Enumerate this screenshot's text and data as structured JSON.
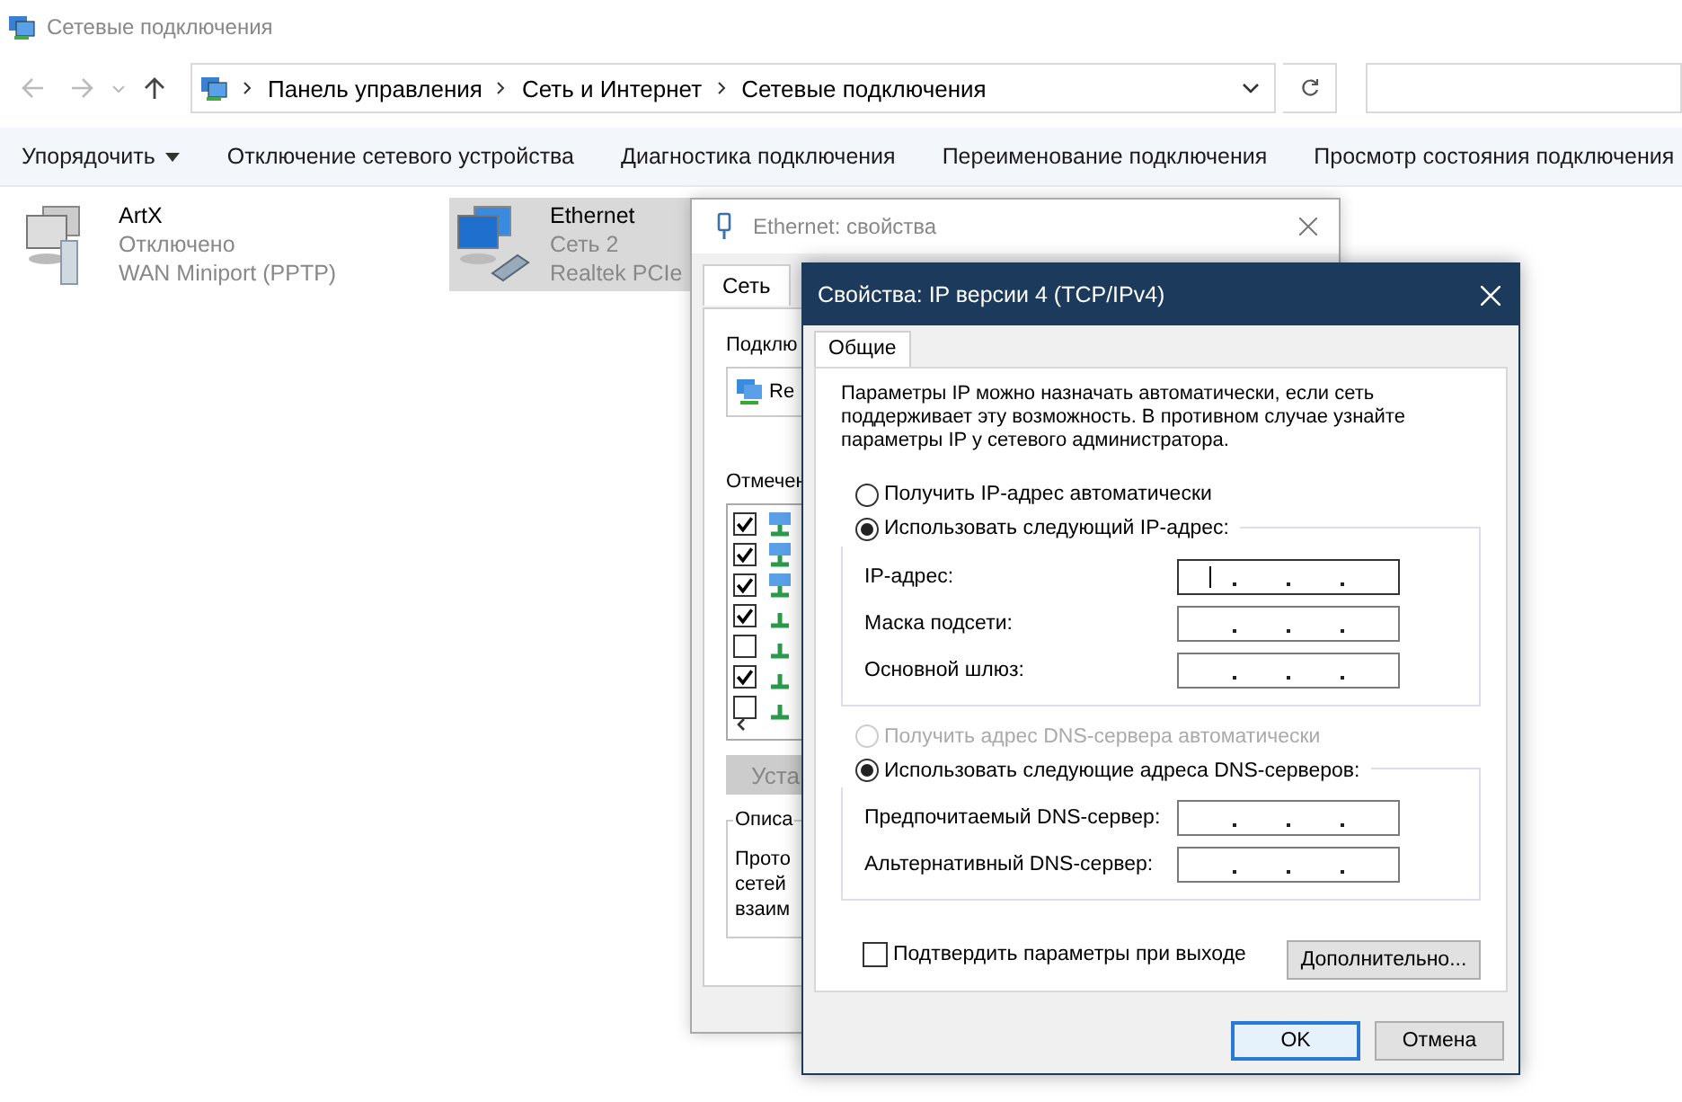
{
  "explorer": {
    "title": "Сетевые подключения",
    "breadcrumb": [
      "Панель управления",
      "Сеть и Интернет",
      "Сетевые подключения"
    ],
    "toolbar": [
      {
        "label": "Упорядочить",
        "dropdown": true
      },
      {
        "label": "Отключение сетевого устройства",
        "dropdown": false
      },
      {
        "label": "Диагностика подключения",
        "dropdown": false
      },
      {
        "label": "Переименование подключения",
        "dropdown": false
      },
      {
        "label": "Просмотр состояния подключения",
        "dropdown": false
      }
    ],
    "connections": [
      {
        "name": "ArtX",
        "status": "Отключено",
        "device": "WAN Miniport (PPTP)",
        "kind": "vpn",
        "selected": false
      },
      {
        "name": "Ethernet",
        "status": "Сеть 2",
        "device": "Realtek PCIe",
        "kind": "ethernet",
        "selected": true
      }
    ]
  },
  "ethernet_dialog": {
    "title": "Ethernet: свойства",
    "tab": "Сеть",
    "connect_label": "Подклю",
    "adapter": "Re",
    "components_label": "Отмечен",
    "components": [
      {
        "checked": true
      },
      {
        "checked": true
      },
      {
        "checked": true
      },
      {
        "checked": true
      },
      {
        "checked": false
      },
      {
        "checked": true
      },
      {
        "checked": false
      }
    ],
    "install_button": "Уста",
    "description_label": "Описа",
    "description_lines": [
      "Прото",
      "сетей",
      "взаим"
    ]
  },
  "ipv4_dialog": {
    "title": "Свойства: IP версии 4 (TCP/IPv4)",
    "tab": "Общие",
    "intro": "Параметры IP можно назначать автоматически, если сеть поддерживает эту возможность. В противном случае узнайте параметры IP у сетевого администратора.",
    "ip_modes": [
      {
        "label": "Получить IP-адрес автоматически",
        "selected": false,
        "disabled": false
      },
      {
        "label": "Использовать следующий IP-адрес:",
        "selected": true,
        "disabled": false
      }
    ],
    "ip_fields": [
      {
        "label": "IP-адрес:",
        "focused": true
      },
      {
        "label": "Маска подсети:",
        "focused": false
      },
      {
        "label": "Основной шлюз:",
        "focused": false
      }
    ],
    "dns_modes": [
      {
        "label": "Получить адрес DNS-сервера автоматически",
        "selected": false,
        "disabled": true
      },
      {
        "label": "Использовать следующие адреса DNS-серверов:",
        "selected": true,
        "disabled": false
      }
    ],
    "dns_fields": [
      {
        "label": "Предпочитаемый DNS-сервер:",
        "focused": false
      },
      {
        "label": "Альтернативный DNS-сервер:",
        "focused": false
      }
    ],
    "confirm": {
      "label": "Подтвердить параметры при выходе",
      "checked": false
    },
    "advanced_button": "Дополнительно...",
    "ok_button": "OK",
    "cancel_button": "Отмена"
  }
}
